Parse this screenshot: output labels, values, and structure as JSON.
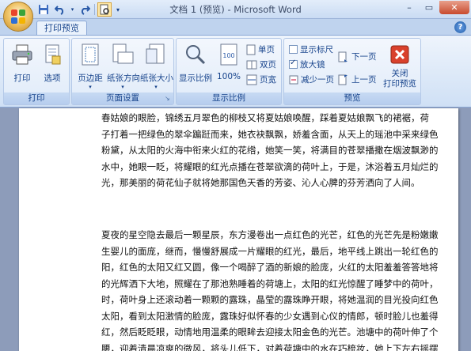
{
  "window": {
    "title": "文档 1 (预览) - Microsoft Word",
    "controls": [
      "–",
      "▭",
      "✕"
    ]
  },
  "tab": {
    "label": "打印预览"
  },
  "help_label": "?",
  "ribbon": {
    "print_group": {
      "label": "打印",
      "print_label": "打印",
      "options_label": "选项"
    },
    "page_setup_group": {
      "label": "页面设置",
      "margins_label": "页边距",
      "orientation_label": "纸张方向",
      "size_label": "纸张大小"
    },
    "zoom_group": {
      "label": "显示比例",
      "zoom_label": "显示比例",
      "hundred_label": "100%",
      "one_page_label": "单页",
      "two_pages_label": "双页",
      "page_width_label": "页宽"
    },
    "preview_group": {
      "label": "预览",
      "show_ruler_label": "显示标尺",
      "show_ruler_checked": false,
      "magnifier_label": "放大镜",
      "magnifier_checked": true,
      "shrink_label": "减少一页",
      "next_page_label": "下一页",
      "prev_page_label": "上一页",
      "close_label": "关闭\n打印预览"
    }
  },
  "document": {
    "paragraph1": [
      "春姑娘的眼脸，锦绣五月翠色的柳枝又将夏姑娘唤醒，踩着夏姑娘飘飞的裙裾，荷",
      "子打着一把绿色的翠伞蹁跹而来，她衣袂飘飘，娇羞含面，从天上的瑶池中采来绿色",
      "粉黛，从太阳的火海中衔来火红的花绺，她笑一笑，将满目的苍翠播撒在烟波飘渺的",
      "水中，她眼一眨，将耀眼的红光点播在苍翠欲滴的荷叶上，于是，沐浴着五月灿烂的",
      "光，那美丽的荷花仙子就将她那国色天香的芳姿、沁人心脾的芬芳洒向了人间。"
    ],
    "paragraph2": [
      "夏夜的星空隐去最后一颗星辰，东方漫卷出一点红色的光芒，红色的光芒先是粉嫩嫩",
      "生婴儿的面庞，继而，慢慢舒展成一片耀眼的红光，最后，地平线上跳出一轮红色的",
      "阳，红色的太阳又红又圆，像一个喝醉了酒的新娘的脸庞，火红的太阳羞羞答答地将",
      "的光辉洒下大地，照耀在了那池熟睡着的荷塘上，太阳的红光惊醒了睡梦中的荷叶，",
      "时，荷叶身上还滚动着一颗颗的露珠，晶莹的露珠睁开眼，将她温润的目光投向红色",
      "太阳，看到太阳激情的脸庞，露珠好似怀春的少女遇到心仪的情郎，顿时脸儿也羞得",
      "红，然后眨眨眼，动情地用温柔的眼眸去迎接太阳金色的光芒。池塘中的荷叶伸了个",
      "腰，迎着清晨凉爽的微风，将头儿低下，对着荷塘中的水在巧梳妆，她上下左右摇摆"
    ]
  }
}
